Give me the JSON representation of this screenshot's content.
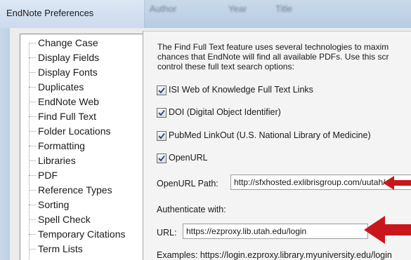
{
  "window": {
    "title": "EndNote Preferences",
    "background_columns": [
      "Author",
      "Year",
      "Title"
    ]
  },
  "tree": {
    "items": [
      {
        "label": "Change Case"
      },
      {
        "label": "Display Fields"
      },
      {
        "label": "Display Fonts"
      },
      {
        "label": "Duplicates"
      },
      {
        "label": "EndNote Web"
      },
      {
        "label": "Find Full Text",
        "selected": true
      },
      {
        "label": "Folder Locations"
      },
      {
        "label": "Formatting"
      },
      {
        "label": "Libraries"
      },
      {
        "label": "PDF"
      },
      {
        "label": "Reference Types"
      },
      {
        "label": "Sorting"
      },
      {
        "label": "Spell Check"
      },
      {
        "label": "Temporary Citations"
      },
      {
        "label": "Term Lists"
      }
    ]
  },
  "panel": {
    "description": [
      "The Find Full Text feature uses several technologies to maxim",
      "chances that EndNote will find all available PDFs. Use this scr",
      "control these full text search options:"
    ],
    "options": [
      {
        "label": "ISI Web of Knowledge Full Text Links",
        "checked": true
      },
      {
        "label": "DOI (Digital Object Identifier)",
        "checked": true
      },
      {
        "label": "PubMed LinkOut (U.S. National Library of Medicine)",
        "checked": true
      },
      {
        "label": "OpenURL",
        "checked": true
      }
    ],
    "openurl_path": {
      "label": "OpenURL Path:",
      "value": "http://sfxhosted.exlibrisgroup.com/uutah/az"
    },
    "authenticate_label": "Authenticate with:",
    "url": {
      "label": "URL:",
      "value": "https://ezproxy.lib.utah.edu/login"
    },
    "examples": "Examples:  https://login.ezproxy.library.myuniversity.edu/login"
  },
  "annotation": {
    "arrow_color": "#c8161c"
  }
}
